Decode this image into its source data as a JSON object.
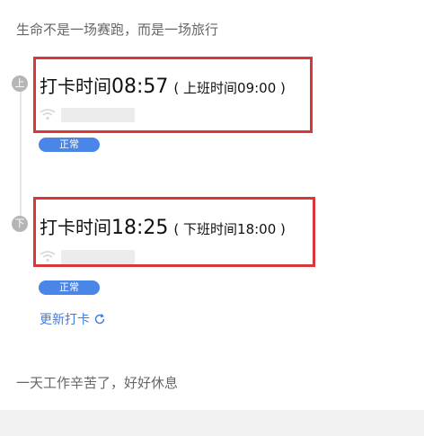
{
  "motto": {
    "top": "生命不是一场赛跑，而是一场旅行",
    "bottom": "一天工作辛苦了，好好休息"
  },
  "records": [
    {
      "marker": "上",
      "label": "打卡时间",
      "time": "08:57",
      "scheduled": "( 上班时间09:00 )",
      "status": "正常",
      "icon": "wifi-icon"
    },
    {
      "marker": "下",
      "label": "打卡时间",
      "time": "18:25",
      "scheduled": "( 下班时间18:00 )",
      "status": "正常",
      "icon": "wifi-icon"
    }
  ],
  "actions": {
    "update_label": "更新打卡",
    "update_icon": "refresh-icon"
  },
  "colors": {
    "highlight": "#d9383b",
    "accent": "#4a86e8",
    "link": "#3c7ce6"
  }
}
